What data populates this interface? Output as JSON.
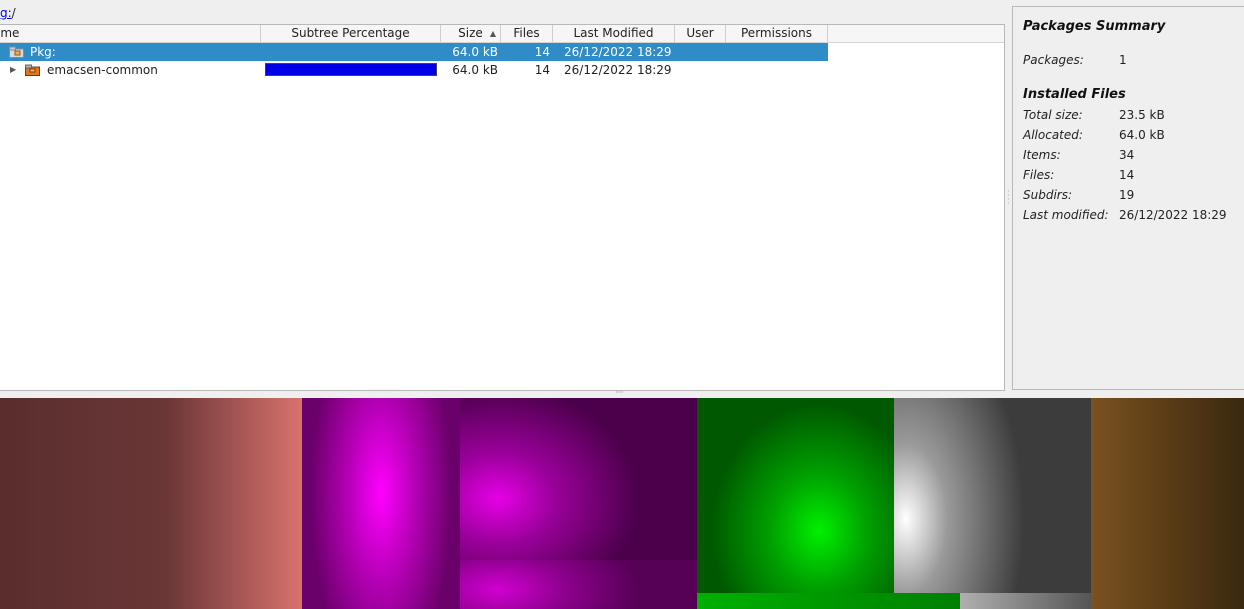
{
  "breadcrumb": {
    "link": "g:",
    "sep": "/"
  },
  "columns": {
    "name": "ame",
    "subtree_percentage": "Subtree Percentage",
    "size": "Size",
    "files": "Files",
    "last_modified": "Last Modified",
    "user": "User",
    "permissions": "Permissions"
  },
  "rows": [
    {
      "name": "Pkg:",
      "size": "64.0 kB",
      "files": "14",
      "last_modified": "26/12/2022 18:29",
      "selected": true
    },
    {
      "name": "emacsen-common",
      "size": "64.0 kB",
      "files": "14",
      "last_modified": "26/12/2022 18:29",
      "subtree_percent": 100,
      "bar_color": "#0000e6"
    }
  ],
  "summary": {
    "packages_title": "Packages Summary",
    "packages_label": "Packages:",
    "packages_value": "1",
    "installed_title": "Installed Files",
    "fields": [
      {
        "label": "Total size:",
        "value": "23.5 kB"
      },
      {
        "label": "Allocated:",
        "value": "64.0 kB"
      },
      {
        "label": "Items:",
        "value": "34"
      },
      {
        "label": "Files:",
        "value": "14"
      },
      {
        "label": "Subdirs:",
        "value": "19"
      },
      {
        "label": "Last modified:",
        "value": "26/12/2022 18:29"
      }
    ]
  },
  "colors": {
    "selection": "#308cc6",
    "percent_bar": "#0000e6"
  }
}
